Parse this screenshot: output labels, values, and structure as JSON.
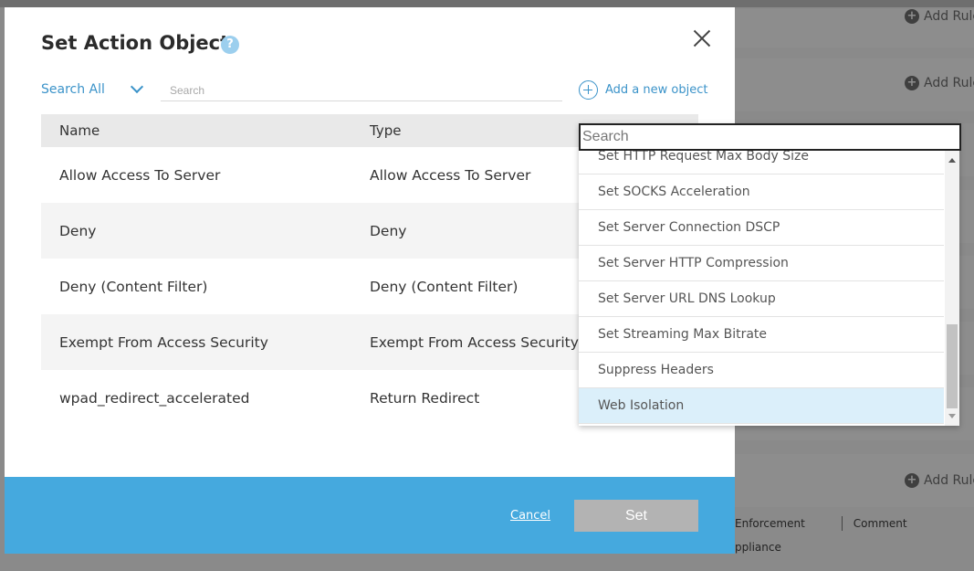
{
  "background": {
    "add_rule_label": "Add Rule",
    "table_headers": [
      "Enforcement",
      "Comment"
    ],
    "cell_text": "ppliance"
  },
  "modal": {
    "title": "Set Action Object",
    "search_scope": "Search All",
    "search_placeholder": "Search",
    "add_object_label": "Add a new object",
    "columns": {
      "name": "Name",
      "type": "Type"
    },
    "rows": [
      {
        "name": "Allow Access To Server",
        "type": "Allow Access To Server"
      },
      {
        "name": "Deny",
        "type": "Deny"
      },
      {
        "name": "Deny (Content Filter)",
        "type": "Deny (Content Filter)"
      },
      {
        "name": "Exempt From Access Security",
        "type": "Exempt From Access Security"
      },
      {
        "name": "wpad_redirect_accelerated",
        "type": "Return Redirect"
      }
    ],
    "cancel_label": "Cancel",
    "set_label": "Set"
  },
  "dropdown": {
    "search_placeholder": "Search",
    "items": [
      "Set HTTP Request Max Body Size",
      "Set SOCKS Acceleration",
      "Set Server Connection DSCP",
      "Set Server HTTP Compression",
      "Set Server URL DNS Lookup",
      "Set Streaming Max Bitrate",
      "Suppress Headers",
      "Web Isolation"
    ],
    "selected": "Web Isolation"
  },
  "colors": {
    "accent": "#3b93c9",
    "footer": "#45a9de",
    "selected_item": "#dbeffa",
    "set_button": "#b3b3b3"
  },
  "icons": [
    "help-icon",
    "close-icon",
    "chevron-down-icon",
    "add-circle-icon",
    "plus-icon",
    "scroll-up-icon",
    "scroll-down-icon"
  ]
}
